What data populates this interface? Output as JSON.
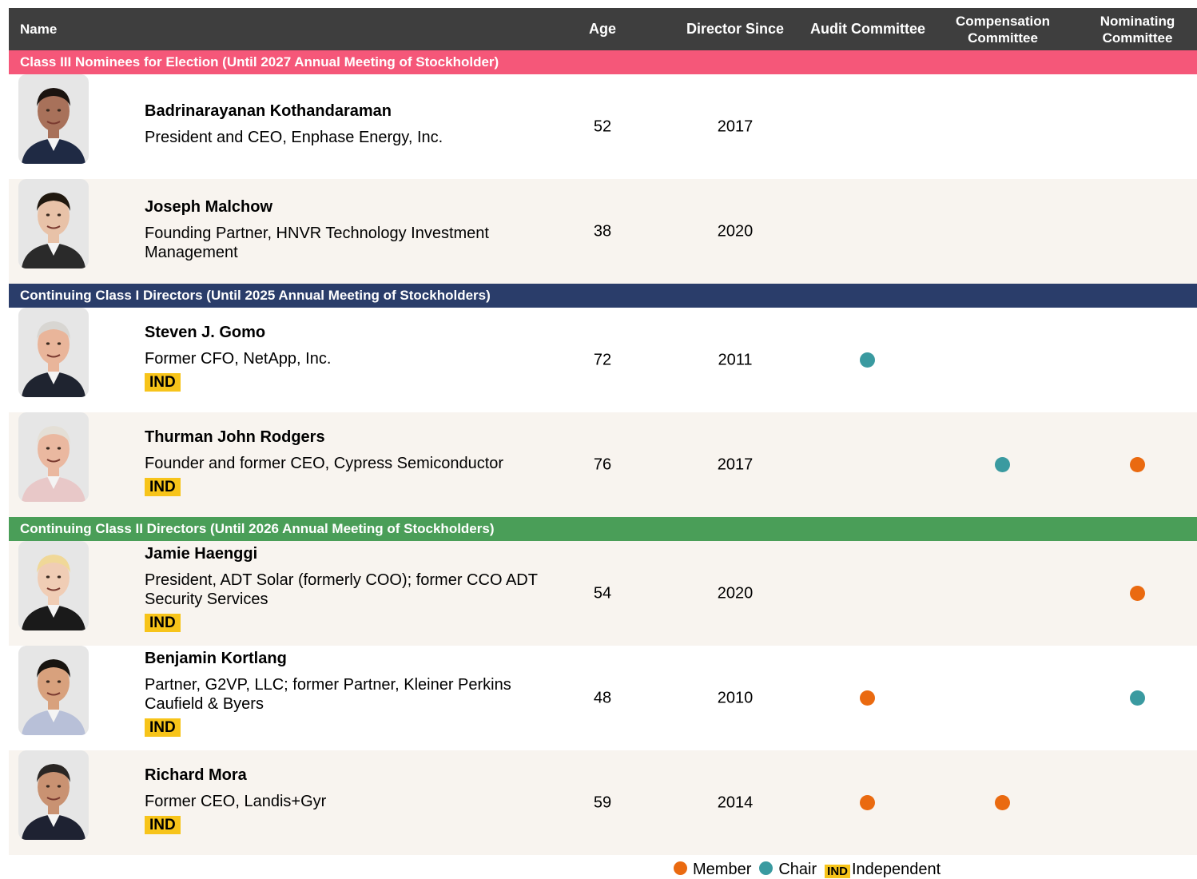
{
  "header": {
    "name": "Name",
    "age": "Age",
    "director_since": "Director Since",
    "audit": "Audit Committee",
    "compensation": "Compensation Committee",
    "nominating": "Nominating Committee"
  },
  "sections": [
    {
      "label": "Class III Nominees for Election (Until 2027 Annual Meeting of Stockholder)",
      "color": "#f55779",
      "directors": [
        {
          "name": "Badrinarayanan Kothandaraman",
          "title": "President and CEO, Enphase Energy, Inc.",
          "independent": "",
          "age": "52",
          "since": "2017",
          "audit": "",
          "compensation": "",
          "nominating": ""
        },
        {
          "name": "Joseph Malchow",
          "title": "Founding Partner, HNVR Technology Investment Management",
          "independent": "",
          "age": "38",
          "since": "2020",
          "audit": "",
          "compensation": "",
          "nominating": ""
        }
      ]
    },
    {
      "label": "Continuing Class I Directors (Until 2025 Annual Meeting of Stockholders)",
      "color": "#2a3d6a",
      "directors": [
        {
          "name": "Steven J. Gomo",
          "title": "Former CFO, NetApp, Inc.",
          "independent": "IND",
          "age": "72",
          "since": "2011",
          "audit": "chair",
          "compensation": "",
          "nominating": ""
        },
        {
          "name": "Thurman John Rodgers",
          "title": "Founder and former CEO, Cypress Semiconductor",
          "independent": "IND",
          "age": "76",
          "since": "2017",
          "audit": "",
          "compensation": "chair",
          "nominating": "member"
        }
      ]
    },
    {
      "label": "Continuing Class II Directors (Until 2026 Annual Meeting of Stockholders)",
      "color": "#4a9e58",
      "directors": [
        {
          "name": "Jamie Haenggi",
          "title": "President, ADT Solar (formerly COO); former CCO ADT Security Services",
          "independent": "IND",
          "age": "54",
          "since": "2020",
          "audit": "",
          "compensation": "",
          "nominating": "member"
        },
        {
          "name": "Benjamin Kortlang",
          "title": "Partner, G2VP, LLC; former Partner, Kleiner Perkins Caufield & Byers",
          "independent": "IND",
          "age": "48",
          "since": "2010",
          "audit": "member",
          "compensation": "",
          "nominating": "chair"
        },
        {
          "name": "Richard Mora",
          "title": "Former CEO, Landis+Gyr",
          "independent": "IND",
          "age": "59",
          "since": "2014",
          "audit": "member",
          "compensation": "member",
          "nominating": ""
        }
      ]
    }
  ],
  "legend": {
    "member": "Member",
    "chair": "Chair",
    "ind_badge": "IND",
    "independent": "Independent"
  },
  "colors": {
    "member": "#ea6a10",
    "chair": "#3a9aa0",
    "independent_badge": "#f7c41a",
    "header": "#3e3e3e",
    "row_alt": "#f8f4ef"
  }
}
